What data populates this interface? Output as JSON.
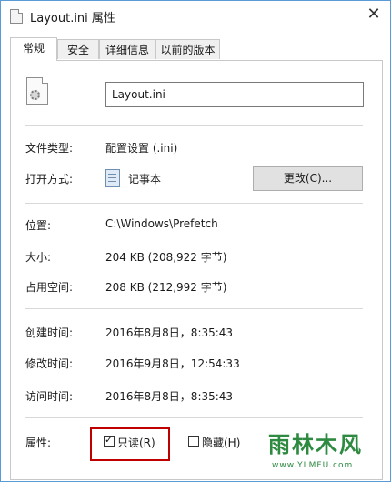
{
  "window": {
    "title": "Layout.ini 属性",
    "close": "✕"
  },
  "tabs": [
    {
      "label": "常规",
      "active": true
    },
    {
      "label": "安全",
      "active": false
    },
    {
      "label": "详细信息",
      "active": false
    },
    {
      "label": "以前的版本",
      "active": false
    }
  ],
  "general": {
    "file_name": "Layout.ini",
    "file_type_label": "文件类型:",
    "file_type": "配置设置 (.ini)",
    "open_with_label": "打开方式:",
    "open_with": "记事本",
    "change_button": "更改(C)...",
    "location_label": "位置:",
    "location": "C:\\Windows\\Prefetch",
    "size_label": "大小:",
    "size": "204 KB (208,922 字节)",
    "size_on_disk_label": "占用空间:",
    "size_on_disk": "208 KB (212,992 字节)",
    "created_label": "创建时间:",
    "created": "2016年8月8日，8:35:43",
    "modified_label": "修改时间:",
    "modified": "2016年9月8日，12:54:33",
    "accessed_label": "访问时间:",
    "accessed": "2016年8月8日，8:35:43",
    "attributes_label": "属性:",
    "readonly_label": "只读(R)",
    "readonly_checked": true,
    "hidden_label": "隐藏(H)",
    "hidden_checked": false
  },
  "watermark": {
    "text": "雨林木风",
    "url": "www.YLMFU.com"
  },
  "colors": {
    "highlight_box": "#c00000",
    "border": "#5b9bd5"
  }
}
